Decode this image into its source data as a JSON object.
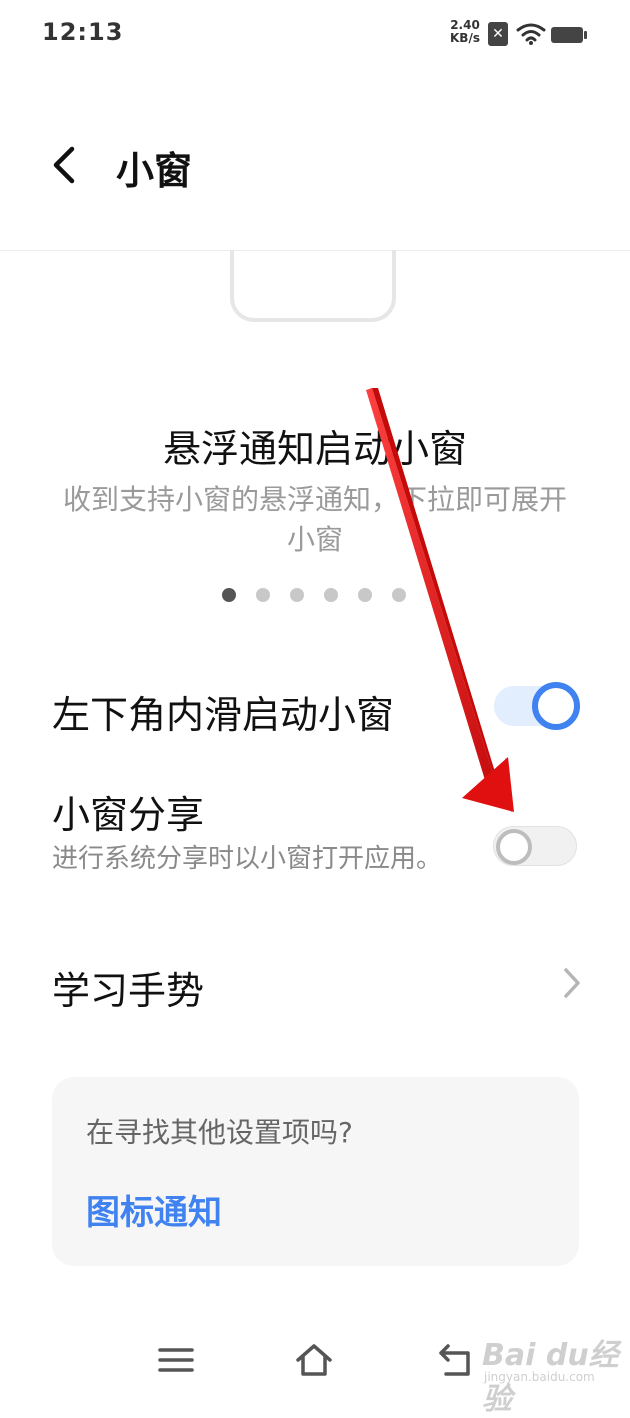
{
  "status_bar": {
    "time": "12:13",
    "net_speed_value": "2.40",
    "net_speed_unit": "KB/s",
    "sim_icon": "sim-off-icon",
    "wifi_icon": "wifi-icon",
    "battery_icon": "battery-icon"
  },
  "header": {
    "back_icon": "chevron-left-icon",
    "title": "小窗"
  },
  "feature": {
    "title": "悬浮通知启动小窗",
    "description": "收到支持小窗的悬浮通知，下拉即可展开小窗",
    "page_count": 6,
    "active_page": 1
  },
  "settings": [
    {
      "title": "左下角内滑启动小窗",
      "toggle": true
    },
    {
      "title": "小窗分享",
      "subtitle": "进行系统分享时以小窗打开应用。",
      "toggle": false
    },
    {
      "title": "学习手势",
      "icon": "chevron-right-icon"
    }
  ],
  "hint_card": {
    "title": "在寻找其他设置项吗?",
    "link": "图标通知"
  },
  "nav_bar": [
    "menu-icon",
    "home-icon",
    "back-icon"
  ],
  "watermark": {
    "logo": "Bai du经验",
    "url": "jingyan.baidu.com"
  },
  "colors": {
    "accent": "#3f82f0",
    "annotation_arrow": "#e01010",
    "muted_text": "#9a9a9a"
  }
}
